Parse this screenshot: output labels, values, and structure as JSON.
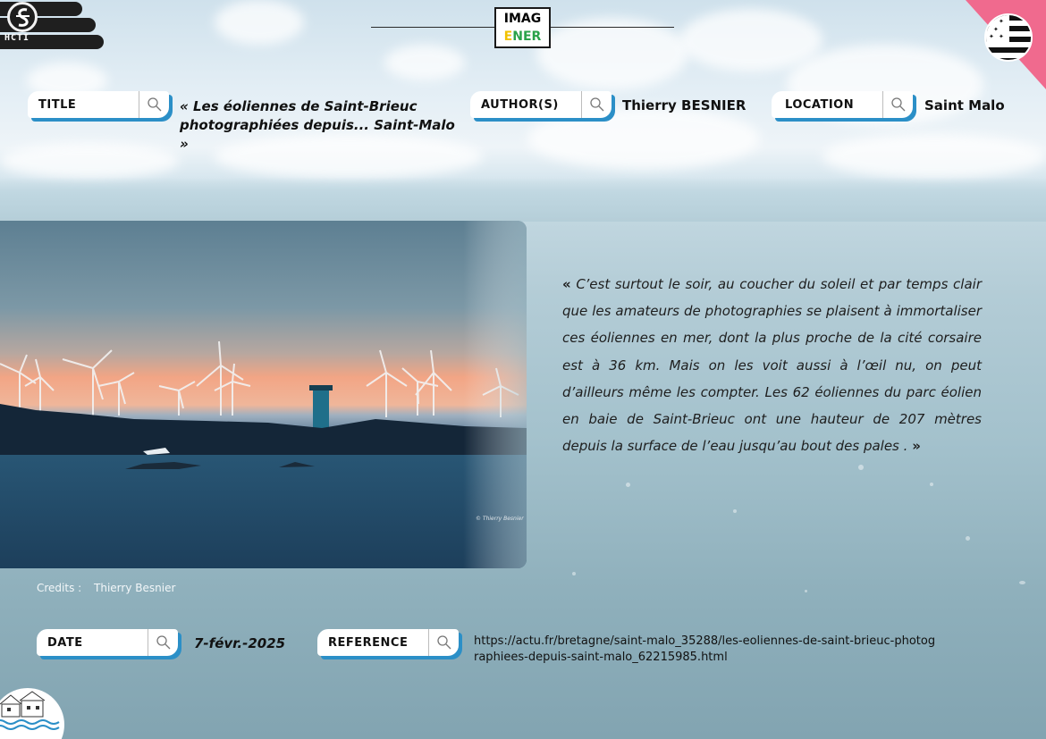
{
  "logo_left": {
    "text": "HCTI"
  },
  "brand": {
    "line1": "IMAG",
    "line2a": "E",
    "line2b": "NER"
  },
  "fields": {
    "title_label": "TITLE",
    "title_value": "« Les éoliennes de Saint-Brieuc photographiées depuis... Saint-Malo »",
    "author_label": "AUTHOR(S)",
    "author_value": "Thierry BESNIER",
    "location_label": "LOCATION",
    "location_value": "Saint Malo",
    "date_label": "DATE",
    "date_value": "7-févr.-2025",
    "reference_label": "REFERENCE",
    "reference_value": "https://actu.fr/bretagne/saint-malo_35288/les-eoliennes-de-saint-brieuc-photographiees-depuis-saint-malo_62215985.html"
  },
  "credits": {
    "label": "Credits :",
    "value": "Thierry Besnier"
  },
  "photo": {
    "watermark": "© Thierry Besnier"
  },
  "quote": {
    "open": "«",
    "text": "C’est surtout le soir, au coucher du soleil et par temps clair que les amateurs de photographies se plaisent à immortaliser ces éoliennes en mer, dont la plus proche de la cité corsaire est à 36 km. Mais on les voit aussi à l’œil nu, on peut d’ailleurs même les compter. Les 62 éoliennes du parc éolien en baie de Saint-Brieuc ont une hauteur de 207 mètres depuis la surface de l’eau jusqu’au bout des pales .",
    "close": "»"
  },
  "icons": [
    "search-icon",
    "brittany-flag-icon",
    "hcti-logo-icon",
    "village-logo-icon"
  ]
}
